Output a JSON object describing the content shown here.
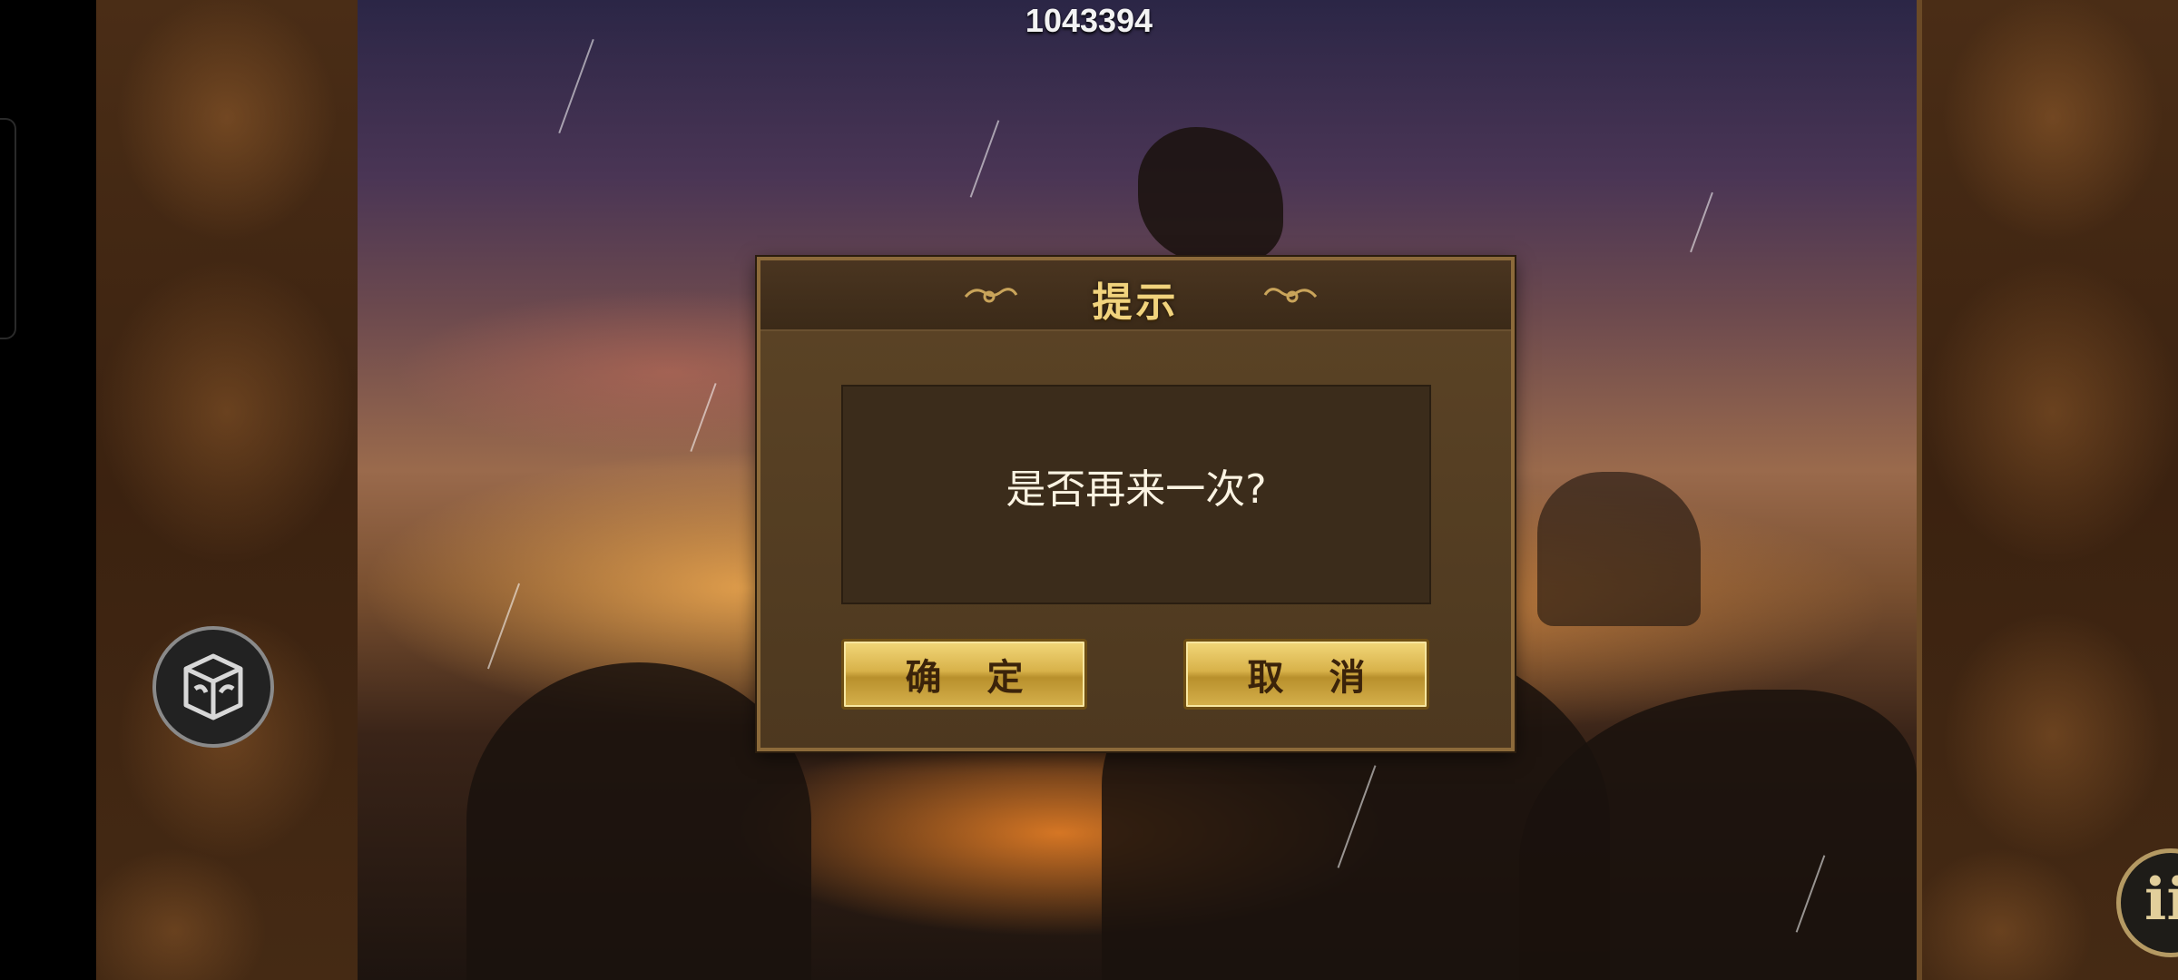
{
  "hud": {
    "score": "1043394"
  },
  "dialog": {
    "title": "提示",
    "message": "是否再来一次?",
    "confirm_label": "确 定",
    "cancel_label": "取 消"
  },
  "corner": {
    "glyph": "ii"
  },
  "colors": {
    "gold": "#f1d37d",
    "panel": "#4d381f",
    "button": "#d8b24a"
  }
}
